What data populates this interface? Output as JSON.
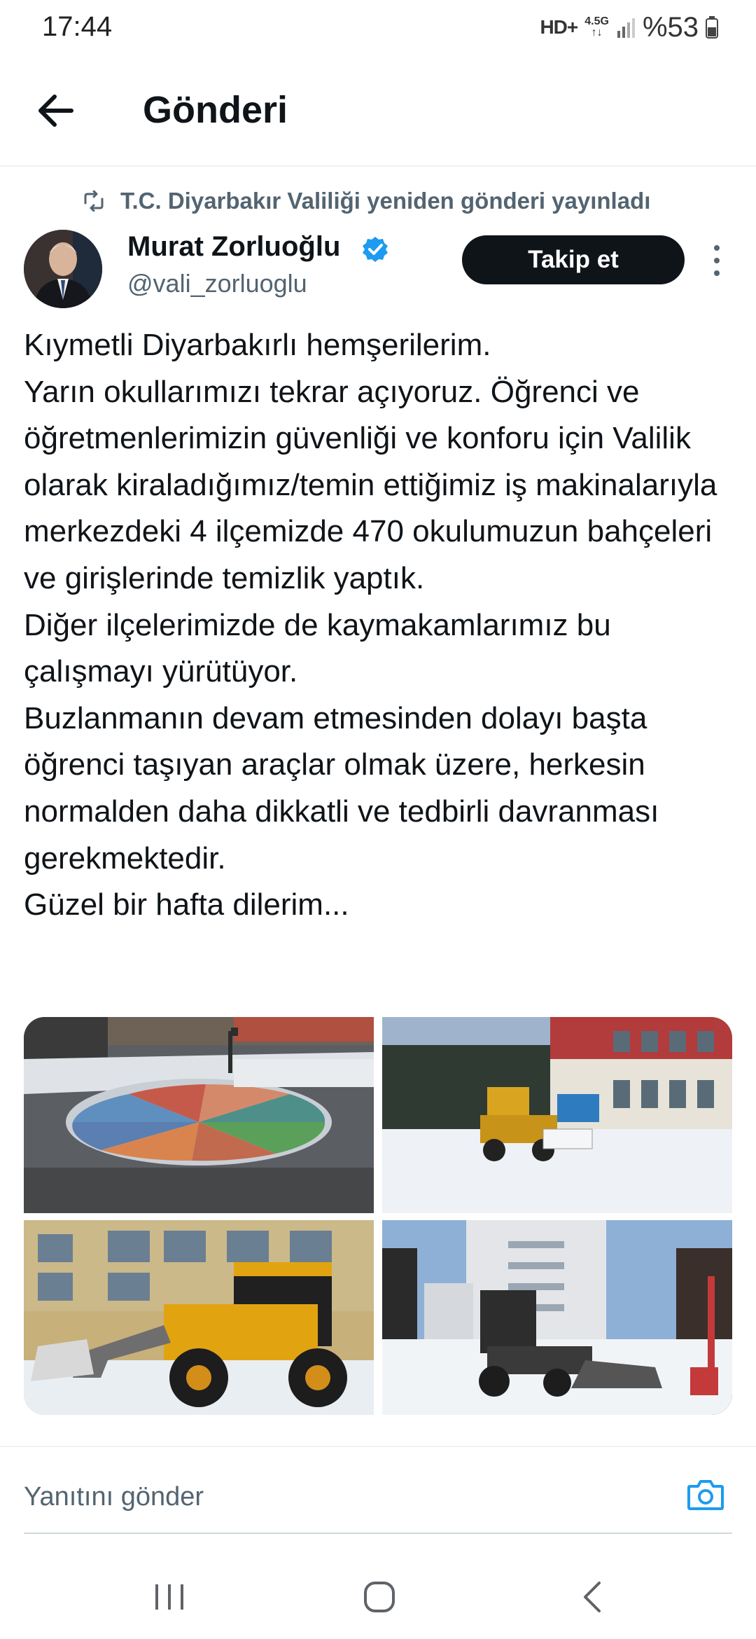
{
  "status_bar": {
    "time": "17:44",
    "network_hd": "HD+",
    "network_type": "4.5G",
    "battery": "%53"
  },
  "header": {
    "title": "Gönderi",
    "back_icon": "arrow-left-icon"
  },
  "repost": {
    "icon": "repost-icon",
    "text": "T.C. Diyarbakır Valiliği yeniden gönderi yayınladı"
  },
  "author": {
    "name": "Murat Zorluoğlu",
    "handle": "@vali_zorluoglu",
    "verified_icon": "verified-badge-icon",
    "follow_label": "Takip et"
  },
  "tweet": {
    "text": "Kıymetli Diyarbakırlı hemşerilerim.\nYarın okullarımızı tekrar açıyoruz. Öğrenci ve öğretmenlerimizin güvenliği ve konforu için Valilik olarak kiraladığımız/temin ettiğimiz iş makinalarıyla merkezdeki 4 ilçemizde 470 okulumuzun bahçeleri ve girişlerinde temizlik yaptık.\nDiğer ilçelerimizde de kaymakamlarımız bu çalışmayı yürütüyor.\nBuzlanmanın devam etmesinden dolayı başta öğrenci taşıyan araçlar olmak üzere, herkesin normalden daha dikkatli ve tedbirli davranması  gerekmektedir.\nGüzel bir hafta dilerim..."
  },
  "reply": {
    "placeholder": "Yanıtını gönder",
    "camera_icon": "camera-icon"
  },
  "nav": {
    "recents_icon": "recents-icon",
    "home_icon": "home-icon",
    "back_icon": "back-chevron-icon"
  },
  "colors": {
    "text": "#0f1419",
    "secondary": "#536471",
    "verified": "#1d9bf0",
    "follow_bg": "#0f1419",
    "divider": "#eff3f4"
  }
}
